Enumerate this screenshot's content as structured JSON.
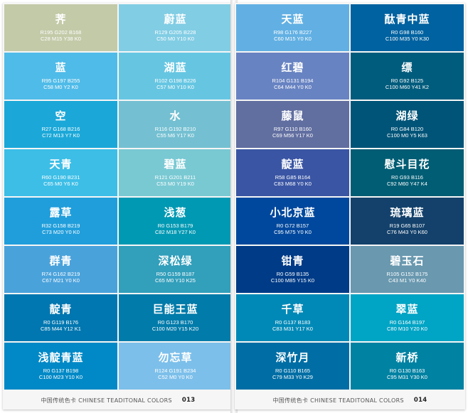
{
  "footer": {
    "left_text": "中国传统色卡 CHINESE TEADITONAL COLORS",
    "left_page": "013",
    "right_text": "中国传统色卡 CHINESE TEADITONAL COLORS",
    "right_page": "014"
  },
  "left_page": [
    {
      "name": "荠",
      "rgb": "R195 G202 B168",
      "cmyk": "C28 M15 Y38 K0",
      "color": "#c3caa8"
    },
    {
      "name": "蔚蓝",
      "rgb": "R129 G205 B228",
      "cmyk": "C50 M0 Y10 K0",
      "color": "#81cde4"
    },
    {
      "name": "蓝",
      "rgb": "R95 G197 B255",
      "cmyk": "C58 M0 Y2 K0",
      "color": "#4fbbe8"
    },
    {
      "name": "湖蓝",
      "rgb": "R102 G198 B226",
      "cmyk": "C57 M0 Y10 K0",
      "color": "#66c6e2"
    },
    {
      "name": "空",
      "rgb": "R27 G168 B216",
      "cmyk": "C72 M13 Y7 K0",
      "color": "#1ba8d8"
    },
    {
      "name": "水",
      "rgb": "R116 G192 B210",
      "cmyk": "C55 M6 Y17 K0",
      "color": "#74c0d2"
    },
    {
      "name": "天青",
      "rgb": "R60 G190 B231",
      "cmyk": "C65 M0 Y6 K0",
      "color": "#3cbee7"
    },
    {
      "name": "碧蓝",
      "rgb": "R121 G201 B211",
      "cmyk": "C53 M0 Y19 K0",
      "color": "#79c9d3"
    },
    {
      "name": "露草",
      "rgb": "R32 G158 B219",
      "cmyk": "C73 M20 Y0 K0",
      "color": "#209edb"
    },
    {
      "name": "浅葱",
      "rgb": "R0 G153 B179",
      "cmyk": "C82 M18 Y27 K0",
      "color": "#0099b3"
    },
    {
      "name": "群青",
      "rgb": "R74 G162 B219",
      "cmyk": "C67 M21 Y0 K0",
      "color": "#4aa2db"
    },
    {
      "name": "深松绿",
      "rgb": "R50 G159 B187",
      "cmyk": "C65 M0 Y10 K25",
      "color": "#329fbb"
    },
    {
      "name": "靛青",
      "rgb": "R0 G119 B176",
      "cmyk": "C85 M44 Y12 K1",
      "color": "#0077b0"
    },
    {
      "name": "巨能王蓝",
      "rgb": "R0 G123 B170",
      "cmyk": "C100 M20 Y15 K20",
      "color": "#007baa"
    },
    {
      "name": "浅靛青蓝",
      "rgb": "R0 G137 B198",
      "cmyk": "C100 M23 Y10 K0",
      "color": "#0089c6"
    },
    {
      "name": "勿忘草",
      "rgb": "R124 G191 B234",
      "cmyk": "C52 M0 Y0 K0",
      "color": "#7cbfea"
    }
  ],
  "right_page": [
    {
      "name": "天蓝",
      "rgb": "R98 G176 B227",
      "cmyk": "C60 M15 Y0 K0",
      "color": "#62b0e3"
    },
    {
      "name": "酞青中蓝",
      "rgb": "R0 G98 B160",
      "cmyk": "C100 M35 Y0 K30",
      "color": "#0062a0"
    },
    {
      "name": "红碧",
      "rgb": "R104 G131 B194",
      "cmyk": "C64 M44 Y0 K0",
      "color": "#6883c2"
    },
    {
      "name": "缥",
      "rgb": "R0 G92 B125",
      "cmyk": "C100 M60 Y41 K2",
      "color": "#005c7d"
    },
    {
      "name": "藤鼠",
      "rgb": "R97 G110 B160",
      "cmyk": "C69 M56 Y17 K0",
      "color": "#616ea0"
    },
    {
      "name": "湖绿",
      "rgb": "R0 G84 B120",
      "cmyk": "C100 M0 Y5 K63",
      "color": "#005478"
    },
    {
      "name": "靛蓝",
      "rgb": "R58 G85 B164",
      "cmyk": "C83 M68 Y0 K0",
      "color": "#3a55a4"
    },
    {
      "name": "慰斗目花",
      "rgb": "R0 G93 B116",
      "cmyk": "C92 M60 Y47 K4",
      "color": "#005d74"
    },
    {
      "name": "小北京蓝",
      "rgb": "R0 G72 B157",
      "cmyk": "C95 M75 Y0 K0",
      "color": "#00489d"
    },
    {
      "name": "琉璃蓝",
      "rgb": "R19 G65 B107",
      "cmyk": "C76 M43 Y0 K60",
      "color": "#13416b"
    },
    {
      "name": "钳青",
      "rgb": "R0 G59 B135",
      "cmyk": "C100 M85 Y15 K0",
      "color": "#003b87"
    },
    {
      "name": "碧玉石",
      "rgb": "R105 G152 B175",
      "cmyk": "C43 M1 Y0 K40",
      "color": "#6998af"
    },
    {
      "name": "千草",
      "rgb": "R0 G137 B183",
      "cmyk": "C83 M31 Y17 K0",
      "color": "#0089b7"
    },
    {
      "name": "翠蓝",
      "rgb": "R0 G164 B197",
      "cmyk": "C80 M10 Y20 K0",
      "color": "#00a4c5"
    },
    {
      "name": "深竹月",
      "rgb": "R0 G110 B165",
      "cmyk": "C79 M33 Y0 K29",
      "color": "#006ea5"
    },
    {
      "name": "新桥",
      "rgb": "R0 G130 B163",
      "cmyk": "C95 M31 Y30 K0",
      "color": "#0082a3"
    }
  ]
}
